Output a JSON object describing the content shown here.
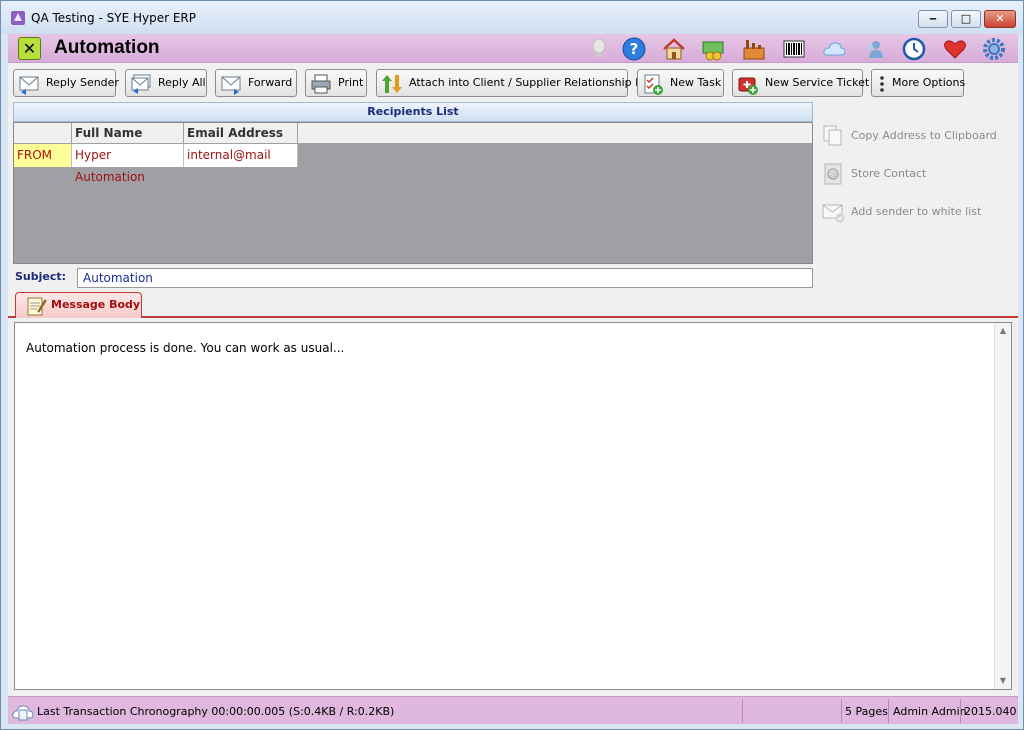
{
  "window": {
    "title": "QA Testing - SYE Hyper ERP",
    "minimize_glyph": "‒",
    "maximize_glyph": "□",
    "close_glyph": "✕"
  },
  "header": {
    "title": "Automation",
    "close_glyph": "✕",
    "icons": [
      "lightbulb-icon",
      "help-icon",
      "home-icon",
      "money-icon",
      "factory-icon",
      "barcode-icon",
      "cloud-icon",
      "users-icon",
      "clock-icon",
      "heart-icon",
      "gear-icon"
    ]
  },
  "toolbar": {
    "reply_sender": "Reply Sender",
    "reply_all": "Reply All",
    "forward": "Forward",
    "print": "Print",
    "attach": "Attach into Client / Supplier Relationship Log",
    "new_task": "New Task",
    "new_service_ticket": "New Service Ticket",
    "more_options": "More Options"
  },
  "recipients": {
    "title": "Recipients List",
    "columns": [
      "",
      "Full Name",
      "Email Address"
    ],
    "rows": [
      {
        "type": "FROM",
        "full_name": "Hyper Automation",
        "email": "internal@mail"
      }
    ]
  },
  "side_actions": {
    "copy": "Copy Address to Clipboard",
    "store": "Store Contact",
    "whitelist": "Add sender to white list"
  },
  "subject": {
    "label": "Subject:",
    "value": "Automation"
  },
  "tab": {
    "label": "Message Body"
  },
  "message": {
    "body": "Automation process is done. You can work as usual..."
  },
  "status": {
    "chronography": "Last Transaction Chronography  00:00:00.005   (S:0.4KB / R:0.2KB)",
    "pages": "5 Pages",
    "user": "Admin Admin",
    "version": "2015.040"
  },
  "colors": {
    "header_bg": "#d8acd8",
    "status_bg": "#dfb7df",
    "accent_red": "#c23a3a",
    "grid_bg": "#a0a0a4"
  }
}
